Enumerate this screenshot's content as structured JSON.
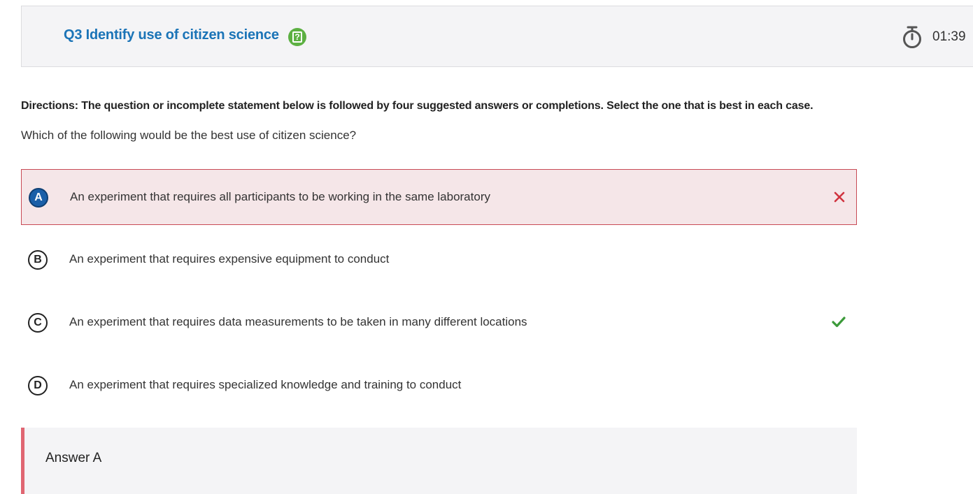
{
  "header": {
    "title": "Q3 Identify use of citizen science",
    "help_icon": "help-icon",
    "timer_icon": "stopwatch-icon",
    "timer": "01:39"
  },
  "directions": "Directions: The question or incomplete statement below is followed by four suggested answers or completions. Select the one that is best in each case.",
  "question": "Which of the following would be the best use of citizen science?",
  "options": [
    {
      "letter": "A",
      "text": "An experiment that requires all participants to be working in the same laboratory",
      "state": "selected-incorrect",
      "mark_icon": "x-icon",
      "mark_color": "#d0333f"
    },
    {
      "letter": "B",
      "text": "An experiment that requires expensive equipment to conduct",
      "state": "none"
    },
    {
      "letter": "C",
      "text": "An experiment that requires data measurements to be taken in many different locations",
      "state": "correct",
      "mark_icon": "check-icon",
      "mark_color": "#3c9a3a"
    },
    {
      "letter": "D",
      "text": "An experiment that requires specialized knowledge and training to conduct",
      "state": "none"
    }
  ],
  "answer": {
    "label": "Answer A",
    "accent_color": "#e06672"
  },
  "colors": {
    "title": "#1b74b7",
    "help_icon": "#5cb042",
    "selected_badge": "#1a5fa8",
    "wrong_background": "#f5e6e8"
  }
}
